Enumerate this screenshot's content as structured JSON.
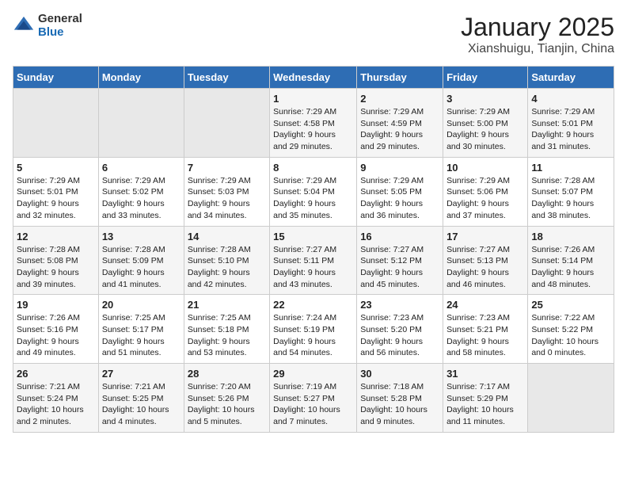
{
  "header": {
    "logo_general": "General",
    "logo_blue": "Blue",
    "title": "January 2025",
    "subtitle": "Xianshuigu, Tianjin, China"
  },
  "days_of_week": [
    "Sunday",
    "Monday",
    "Tuesday",
    "Wednesday",
    "Thursday",
    "Friday",
    "Saturday"
  ],
  "weeks": [
    [
      {
        "num": "",
        "info": ""
      },
      {
        "num": "",
        "info": ""
      },
      {
        "num": "",
        "info": ""
      },
      {
        "num": "1",
        "info": "Sunrise: 7:29 AM\nSunset: 4:58 PM\nDaylight: 9 hours\nand 29 minutes."
      },
      {
        "num": "2",
        "info": "Sunrise: 7:29 AM\nSunset: 4:59 PM\nDaylight: 9 hours\nand 29 minutes."
      },
      {
        "num": "3",
        "info": "Sunrise: 7:29 AM\nSunset: 5:00 PM\nDaylight: 9 hours\nand 30 minutes."
      },
      {
        "num": "4",
        "info": "Sunrise: 7:29 AM\nSunset: 5:01 PM\nDaylight: 9 hours\nand 31 minutes."
      }
    ],
    [
      {
        "num": "5",
        "info": "Sunrise: 7:29 AM\nSunset: 5:01 PM\nDaylight: 9 hours\nand 32 minutes."
      },
      {
        "num": "6",
        "info": "Sunrise: 7:29 AM\nSunset: 5:02 PM\nDaylight: 9 hours\nand 33 minutes."
      },
      {
        "num": "7",
        "info": "Sunrise: 7:29 AM\nSunset: 5:03 PM\nDaylight: 9 hours\nand 34 minutes."
      },
      {
        "num": "8",
        "info": "Sunrise: 7:29 AM\nSunset: 5:04 PM\nDaylight: 9 hours\nand 35 minutes."
      },
      {
        "num": "9",
        "info": "Sunrise: 7:29 AM\nSunset: 5:05 PM\nDaylight: 9 hours\nand 36 minutes."
      },
      {
        "num": "10",
        "info": "Sunrise: 7:29 AM\nSunset: 5:06 PM\nDaylight: 9 hours\nand 37 minutes."
      },
      {
        "num": "11",
        "info": "Sunrise: 7:28 AM\nSunset: 5:07 PM\nDaylight: 9 hours\nand 38 minutes."
      }
    ],
    [
      {
        "num": "12",
        "info": "Sunrise: 7:28 AM\nSunset: 5:08 PM\nDaylight: 9 hours\nand 39 minutes."
      },
      {
        "num": "13",
        "info": "Sunrise: 7:28 AM\nSunset: 5:09 PM\nDaylight: 9 hours\nand 41 minutes."
      },
      {
        "num": "14",
        "info": "Sunrise: 7:28 AM\nSunset: 5:10 PM\nDaylight: 9 hours\nand 42 minutes."
      },
      {
        "num": "15",
        "info": "Sunrise: 7:27 AM\nSunset: 5:11 PM\nDaylight: 9 hours\nand 43 minutes."
      },
      {
        "num": "16",
        "info": "Sunrise: 7:27 AM\nSunset: 5:12 PM\nDaylight: 9 hours\nand 45 minutes."
      },
      {
        "num": "17",
        "info": "Sunrise: 7:27 AM\nSunset: 5:13 PM\nDaylight: 9 hours\nand 46 minutes."
      },
      {
        "num": "18",
        "info": "Sunrise: 7:26 AM\nSunset: 5:14 PM\nDaylight: 9 hours\nand 48 minutes."
      }
    ],
    [
      {
        "num": "19",
        "info": "Sunrise: 7:26 AM\nSunset: 5:16 PM\nDaylight: 9 hours\nand 49 minutes."
      },
      {
        "num": "20",
        "info": "Sunrise: 7:25 AM\nSunset: 5:17 PM\nDaylight: 9 hours\nand 51 minutes."
      },
      {
        "num": "21",
        "info": "Sunrise: 7:25 AM\nSunset: 5:18 PM\nDaylight: 9 hours\nand 53 minutes."
      },
      {
        "num": "22",
        "info": "Sunrise: 7:24 AM\nSunset: 5:19 PM\nDaylight: 9 hours\nand 54 minutes."
      },
      {
        "num": "23",
        "info": "Sunrise: 7:23 AM\nSunset: 5:20 PM\nDaylight: 9 hours\nand 56 minutes."
      },
      {
        "num": "24",
        "info": "Sunrise: 7:23 AM\nSunset: 5:21 PM\nDaylight: 9 hours\nand 58 minutes."
      },
      {
        "num": "25",
        "info": "Sunrise: 7:22 AM\nSunset: 5:22 PM\nDaylight: 10 hours\nand 0 minutes."
      }
    ],
    [
      {
        "num": "26",
        "info": "Sunrise: 7:21 AM\nSunset: 5:24 PM\nDaylight: 10 hours\nand 2 minutes."
      },
      {
        "num": "27",
        "info": "Sunrise: 7:21 AM\nSunset: 5:25 PM\nDaylight: 10 hours\nand 4 minutes."
      },
      {
        "num": "28",
        "info": "Sunrise: 7:20 AM\nSunset: 5:26 PM\nDaylight: 10 hours\nand 5 minutes."
      },
      {
        "num": "29",
        "info": "Sunrise: 7:19 AM\nSunset: 5:27 PM\nDaylight: 10 hours\nand 7 minutes."
      },
      {
        "num": "30",
        "info": "Sunrise: 7:18 AM\nSunset: 5:28 PM\nDaylight: 10 hours\nand 9 minutes."
      },
      {
        "num": "31",
        "info": "Sunrise: 7:17 AM\nSunset: 5:29 PM\nDaylight: 10 hours\nand 11 minutes."
      },
      {
        "num": "",
        "info": ""
      }
    ]
  ]
}
